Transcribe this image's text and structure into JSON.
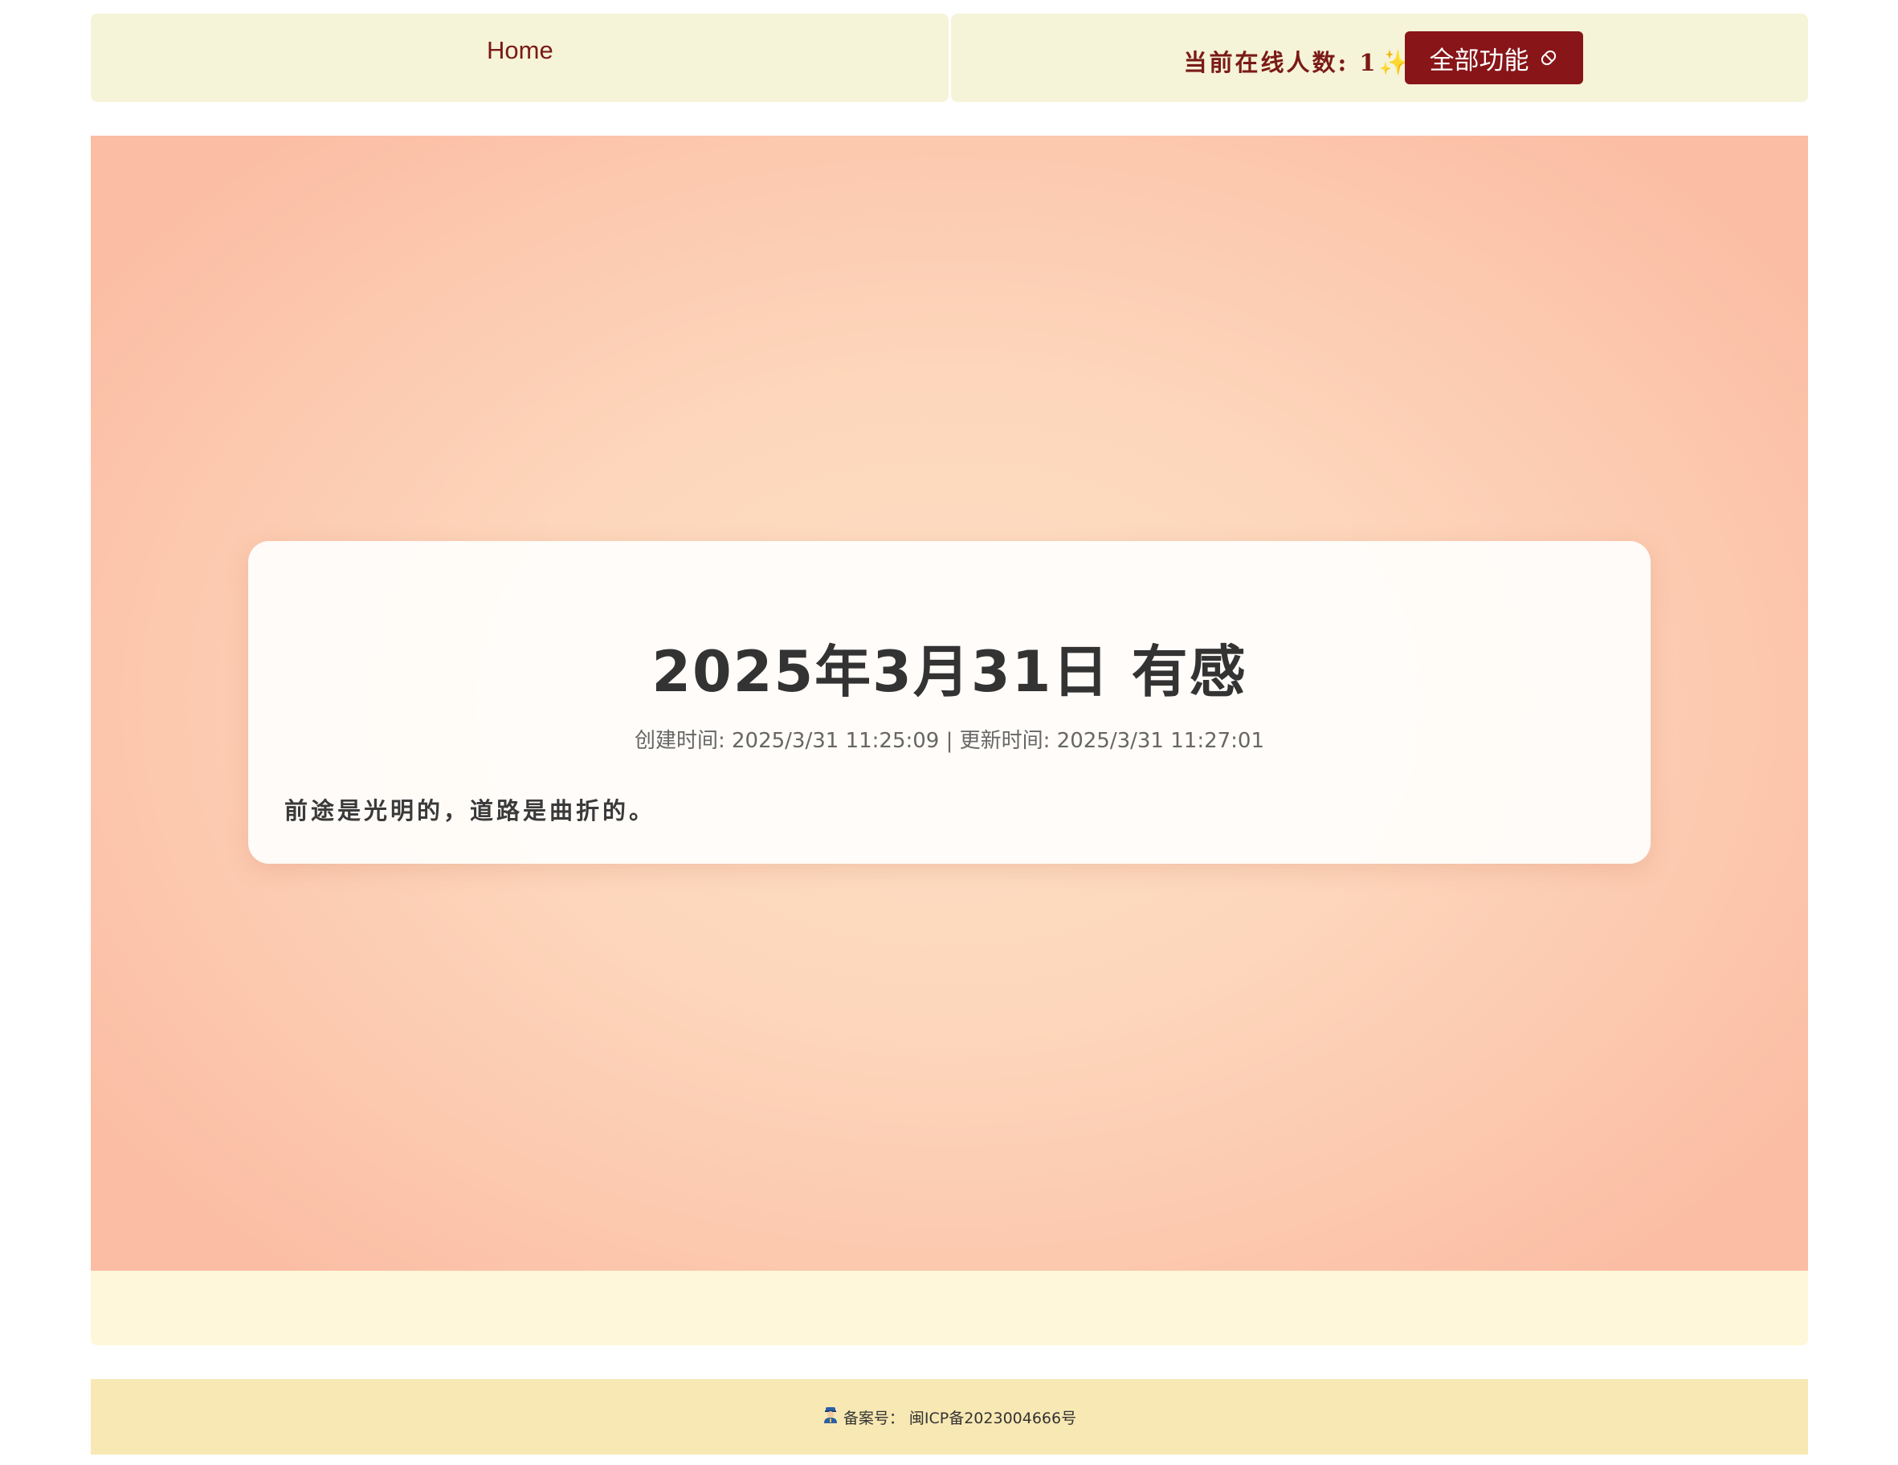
{
  "nav": {
    "home_label": "Home",
    "online_label": "当前在线人数:",
    "online_count": "1",
    "sparkle_icon": "✨",
    "all_features_label": "全部功能",
    "all_features_icon": "pill-icon"
  },
  "article": {
    "title": "2025年3月31日 有感",
    "meta": "创建时间: 2025/3/31 11:25:09 | 更新时间: 2025/3/31 11:27:01",
    "body": "前途是光明的，道路是曲折的。"
  },
  "footer": {
    "icon": "police-icon",
    "record_label": "备案号：",
    "record_number": "闽ICP备2023004666号"
  },
  "colors": {
    "accent": "#881518",
    "nav_text": "#7a1a16",
    "header_bg": "#f5f3d8",
    "footer_bg": "#f8e8b3",
    "band_bg": "#fef7d9"
  }
}
